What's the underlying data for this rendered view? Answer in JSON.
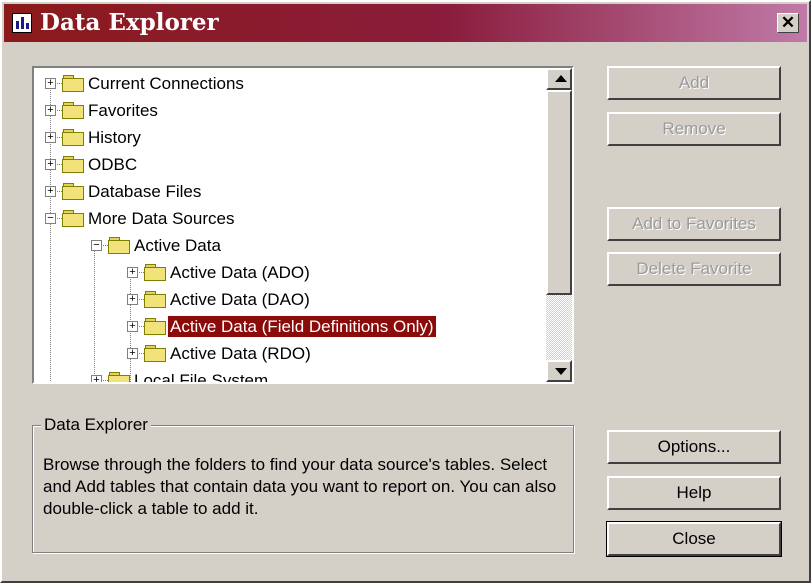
{
  "window": {
    "title": "Data Explorer",
    "close_glyph": "✕",
    "accent_color": "#8b1a1a"
  },
  "tree": {
    "nodes": [
      {
        "label": "Current Connections",
        "expander": "+"
      },
      {
        "label": "Favorites",
        "expander": "+"
      },
      {
        "label": "History",
        "expander": "+"
      },
      {
        "label": "ODBC",
        "expander": "+"
      },
      {
        "label": "Database Files",
        "expander": "+"
      },
      {
        "label": "More Data Sources",
        "expander": "−"
      },
      {
        "label": "Active Data",
        "expander": "−"
      },
      {
        "label": "Active Data (ADO)",
        "expander": "+"
      },
      {
        "label": "Active Data (DAO)",
        "expander": "+"
      },
      {
        "label": "Active Data (Field Definitions Only)",
        "expander": "+",
        "selected": true
      },
      {
        "label": "Active Data (RDO)",
        "expander": "+"
      },
      {
        "label": "Local File System",
        "expander": "+"
      }
    ],
    "selection_color": "#8b0a0a"
  },
  "buttons": {
    "add": "Add",
    "remove": "Remove",
    "add_to_favorites": "Add to Favorites",
    "delete_favorite": "Delete Favorite",
    "options": "Options...",
    "help": "Help",
    "close": "Close"
  },
  "info": {
    "legend": "Data Explorer",
    "description": "Browse through the folders to find your data source's tables.  Select and Add tables that contain data you want to report on.  You can also double-click a table to add it."
  }
}
